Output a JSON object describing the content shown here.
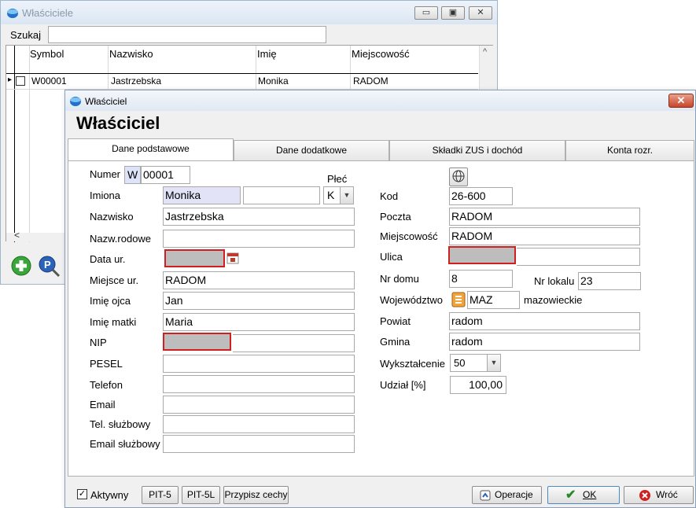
{
  "back_window": {
    "title": "Właściciele",
    "search_label": "Szukaj",
    "search_value": "",
    "columns": [
      "Symbol",
      "Nazwisko",
      "Imię",
      "Miejscowość"
    ],
    "row": {
      "symbol": "W00001",
      "nazwisko": "Jastrzebska",
      "imie": "Monika",
      "miejscowosc": "RADOM"
    },
    "min_glyph": "▭",
    "max_glyph": "▣",
    "close_glyph": "✕",
    "scroll_left": "<",
    "scroll_up": "^",
    "row_marker": "▸"
  },
  "dialog": {
    "window_title": "Właściciel",
    "heading": "Właściciel",
    "close_glyph": "✕",
    "tabs": [
      "Dane podstawowe",
      "Dane dodatkowe",
      "Składki ZUS i dochód",
      "Konta rozr."
    ],
    "left": {
      "numer_label": "Numer",
      "numer_prefix": "W",
      "numer_value": "00001",
      "plec_label": "Płeć",
      "plec_value": "K",
      "imiona_label": "Imiona",
      "imiona_value": "Monika",
      "imiona2_value": "",
      "nazwisko_label": "Nazwisko",
      "nazwisko_value": "Jastrzebska",
      "nazw_rodowe_label": "Nazw.rodowe",
      "nazw_rodowe_value": "",
      "data_ur_label": "Data ur.",
      "data_ur_value": "",
      "miejsce_ur_label": "Miejsce ur.",
      "miejsce_ur_value": "RADOM",
      "imie_ojca_label": "Imię ojca",
      "imie_ojca_value": "Jan",
      "imie_matki_label": "Imię matki",
      "imie_matki_value": "Maria",
      "nip_label": "NIP",
      "nip_value": "",
      "pesel_label": "PESEL",
      "pesel_value": "",
      "telefon_label": "Telefon",
      "telefon_value": "",
      "email_label": "Email",
      "email_value": "",
      "tel_sluzbowy_label": "Tel. służbowy",
      "tel_sluzbowy_value": "",
      "email_sluzbowy_label": "Email służbowy",
      "email_sluzbowy_value": ""
    },
    "right": {
      "kod_label": "Kod",
      "kod_value": "26-600",
      "poczta_label": "Poczta",
      "poczta_value": "RADOM",
      "miejscowosc_label": "Miejscowość",
      "miejscowosc_value": "RADOM",
      "ulica_label": "Ulica",
      "ulica_value": "",
      "nr_domu_label": "Nr domu",
      "nr_domu_value": "8",
      "nr_lokalu_label": "Nr lokalu",
      "nr_lokalu_value": "23",
      "wojewodztwo_label": "Województwo",
      "wojewodztwo_code": "MAZ",
      "wojewodztwo_name": "mazowieckie",
      "powiat_label": "Powiat",
      "powiat_value": "radom",
      "gmina_label": "Gmina",
      "gmina_value": "radom",
      "wyksztalcenie_label": "Wykształcenie",
      "wyksztalcenie_value": "50",
      "udzial_label": "Udział [%]",
      "udzial_value": "100,00"
    },
    "footer": {
      "aktywny_label": "Aktywny",
      "aktywny_checked": true,
      "pit5_label": "PIT-5",
      "pit5l_label": "PIT-5L",
      "przypisz_label": "Przypisz cechy",
      "operacje_label": "Operacje",
      "ok_label": "OK",
      "wroc_label": "Wróć"
    }
  },
  "colors": {
    "highlight_red": "#d01f1f",
    "masked_gray": "#bdbdbd",
    "imiona_bg": "#e3e3f8",
    "ok_green": "#2a8a2a",
    "wroc_red": "#d02020"
  }
}
